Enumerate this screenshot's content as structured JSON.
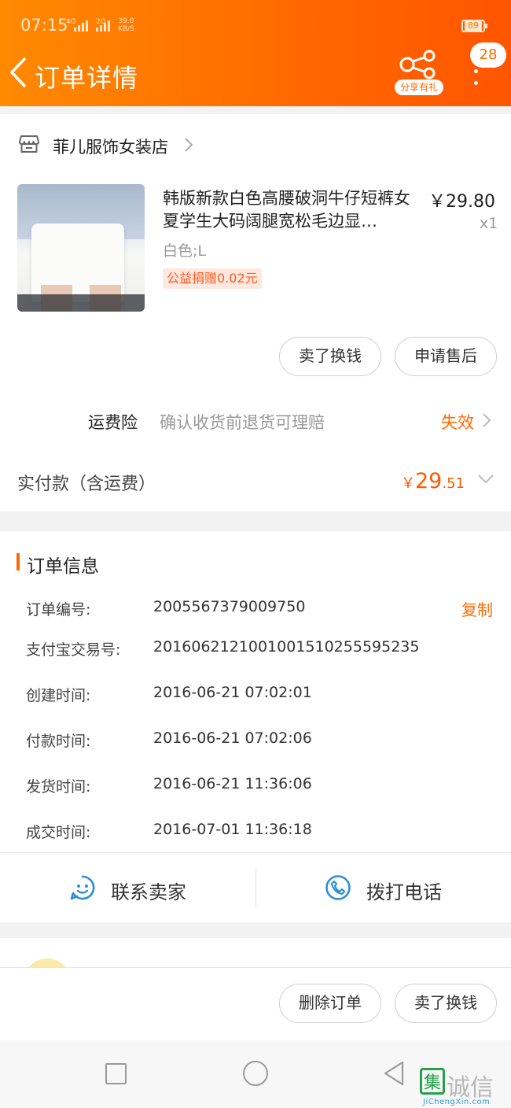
{
  "status_bar": {
    "time": "07:15",
    "sig1_top": "4G",
    "sig2_top": "2G",
    "speed_value": "39.0",
    "speed_unit": "KB/S",
    "battery": "89"
  },
  "header": {
    "title": "订单详情",
    "share_label": "分享有礼",
    "message_count": "28"
  },
  "store": {
    "name": "菲儿服饰女装店"
  },
  "product": {
    "name": "韩版新款白色高腰破洞牛仔短裤女夏学生大码阔腿宽松毛边显…",
    "price": "￥29.80",
    "quantity": "x1",
    "sku": "白色;L",
    "donation": "公益捐赠0.02元"
  },
  "product_actions": {
    "sell_label": "卖了换钱",
    "after_sale_label": "申请售后"
  },
  "insurance": {
    "label": "运费险",
    "description": "确认收货前退货可理赔",
    "status": "失效"
  },
  "payment": {
    "label": "实付款（含运费）",
    "currency": "￥",
    "amount_int": "29",
    "amount_dec": ".51"
  },
  "order_info": {
    "title": "订单信息",
    "copy_label": "复制",
    "rows": [
      {
        "label": "订单编号:",
        "value": "2005567379009750"
      },
      {
        "label": "支付宝交易号:",
        "value": "2016062121001001510255595235"
      },
      {
        "label": "创建时间:",
        "value": "2016-06-21 07:02:01"
      },
      {
        "label": "付款时间:",
        "value": "2016-06-21 07:02:06"
      },
      {
        "label": "发货时间:",
        "value": "2016-06-21 11:36:06"
      },
      {
        "label": "成交时间:",
        "value": "2016-07-01 11:36:18"
      }
    ]
  },
  "contact": {
    "seller_label": "联系卖家",
    "phone_label": "拨打电话"
  },
  "bottom_actions": {
    "delete_label": "删除订单",
    "sell_label": "卖了换钱"
  },
  "watermark": {
    "text": "诚信",
    "mark": "集",
    "url": "JiChengXin.com"
  },
  "colors": {
    "accent": "#ff6a00",
    "link": "#2b8fd6"
  }
}
